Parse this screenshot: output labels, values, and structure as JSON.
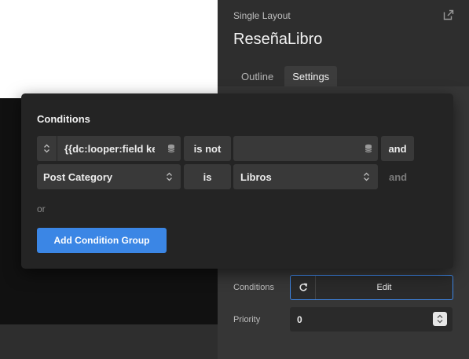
{
  "panel": {
    "type_label": "Single Layout",
    "title": "ReseñaLibro",
    "tabs": [
      {
        "label": "Outline",
        "active": false
      },
      {
        "label": "Settings",
        "active": true
      }
    ],
    "conditions_label": "Conditions",
    "conditions_button": "Edit",
    "priority_label": "Priority",
    "priority_value": "0"
  },
  "popover": {
    "title": "Conditions",
    "rows": [
      {
        "field": "{{dc:looper:field key}}",
        "operator": "is not",
        "value": "",
        "conjunction": "and"
      },
      {
        "field": "Post Category",
        "operator": "is",
        "value": "Libros",
        "conjunction": "and"
      }
    ],
    "or_label": "or",
    "add_group_label": "Add Condition Group"
  },
  "colors": {
    "accent": "#3b86e5",
    "panel_bg": "#2e2e2e",
    "popover_bg": "#242424",
    "control_bg": "#393939"
  }
}
